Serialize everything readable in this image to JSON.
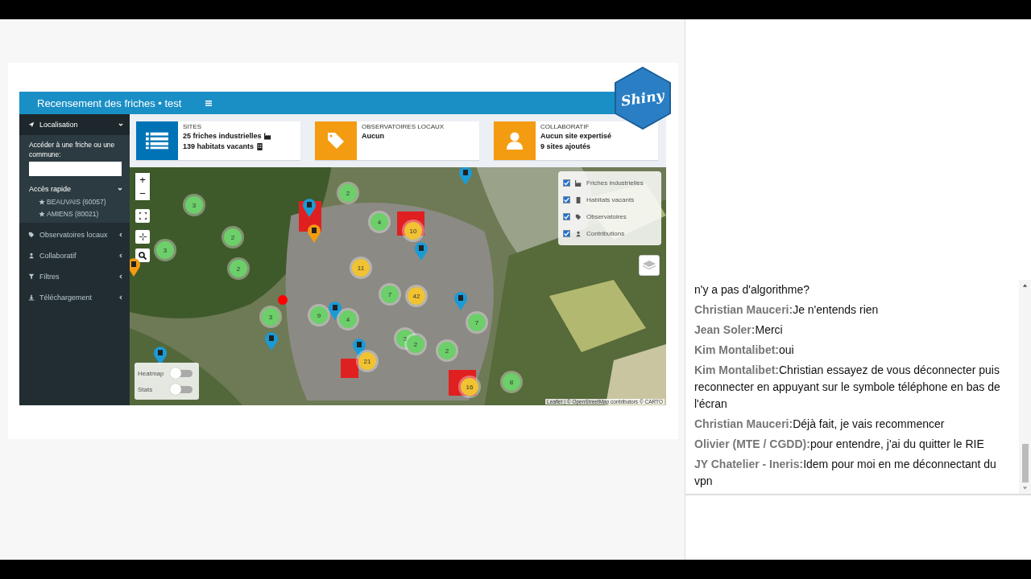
{
  "app": {
    "title": "Recensement des friches • test",
    "logo": "Shiny"
  },
  "sidebar": {
    "items": [
      {
        "label": "Localisation",
        "expanded": true
      },
      {
        "label": "Observatoires locaux",
        "expanded": false
      },
      {
        "label": "Collaboratif",
        "expanded": false
      },
      {
        "label": "Filtres",
        "expanded": false
      },
      {
        "label": "Téléchargement",
        "expanded": false
      }
    ],
    "search_label": "Accéder à une friche ou une commune:",
    "quick_access": {
      "label": "Accès rapide",
      "expanded": true,
      "items": [
        "BEAUVAIS (60057)",
        "AMIENS (80021)"
      ]
    }
  },
  "info_boxes": [
    {
      "kind": "list",
      "color": "#0073b7",
      "title": "SITES",
      "lines": [
        {
          "text": "25 friches industrielles"
        },
        {
          "text": "139 habitats vacants"
        }
      ]
    },
    {
      "kind": "tag",
      "color": "#f39c12",
      "title": "OBSERVATOIRES LOCAUX",
      "lines": [
        {
          "text": "Aucun"
        }
      ]
    },
    {
      "kind": "user",
      "color": "#f39c12",
      "title": "COLLABORATIF",
      "lines": [
        {
          "text": "Aucun site expertisé"
        },
        {
          "text": "9 sites ajoutés"
        }
      ]
    }
  ],
  "map": {
    "zoom_in": "+",
    "zoom_out": "−",
    "legend": [
      {
        "label": "Friches industrielles",
        "checked": true
      },
      {
        "label": "Habitats vacants",
        "checked": true
      },
      {
        "label": "Observatoires",
        "checked": true
      },
      {
        "label": "Contributions",
        "checked": true
      }
    ],
    "toggles": [
      {
        "label": "Heatmap",
        "on": false
      },
      {
        "label": "Stats",
        "on": false
      }
    ],
    "attribution": "Leaflet | © OpenStreetMap contributors © CARTO",
    "clusters": [
      {
        "count": "3",
        "color": "#6ccf6a"
      },
      {
        "count": "2",
        "color": "#6ccf6a"
      },
      {
        "count": "2",
        "color": "#6ccf6a"
      },
      {
        "count": "3",
        "color": "#6ccf6a"
      },
      {
        "count": "2",
        "color": "#6ccf6a"
      },
      {
        "count": "4",
        "color": "#6ccf6a"
      },
      {
        "count": "10",
        "color": "#f1c232"
      },
      {
        "count": "11",
        "color": "#f1c232"
      },
      {
        "count": "7",
        "color": "#6ccf6a"
      },
      {
        "count": "42",
        "color": "#f1c232"
      },
      {
        "count": "3",
        "color": "#6ccf6a"
      },
      {
        "count": "9",
        "color": "#6ccf6a"
      },
      {
        "count": "4",
        "color": "#6ccf6a"
      },
      {
        "count": "3",
        "color": "#6ccf6a"
      },
      {
        "count": "2",
        "color": "#6ccf6a"
      },
      {
        "count": "21",
        "color": "#f1c232"
      },
      {
        "count": "7",
        "color": "#6ccf6a"
      },
      {
        "count": "2",
        "color": "#6ccf6a"
      },
      {
        "count": "16",
        "color": "#f1c232"
      },
      {
        "count": "8",
        "color": "#6ccf6a"
      }
    ]
  },
  "chat": [
    {
      "text": "n'y a pas d'algorithme?"
    },
    {
      "author": "Christian Mauceri:",
      "text": "Je n'entends rien"
    },
    {
      "author": "Jean Soler:",
      "text": "Merci"
    },
    {
      "author": "Kim Montalibet:",
      "text": "oui"
    },
    {
      "author": "Kim Montalibet:",
      "text": "Christian essayez de vous déconnecter puis reconnecter en appuyant sur le symbole téléphone en bas de l'écran"
    },
    {
      "author": "Christian Mauceri:",
      "text": "Déjà fait, je vais recommencer"
    },
    {
      "author": "Olivier (MTE / CGDD):",
      "text": "pour entendre, j'ai du quitter le RIE"
    },
    {
      "author": "JY Chatelier - Ineris:",
      "text": "Idem pour moi en me déconnectant du vpn"
    }
  ]
}
